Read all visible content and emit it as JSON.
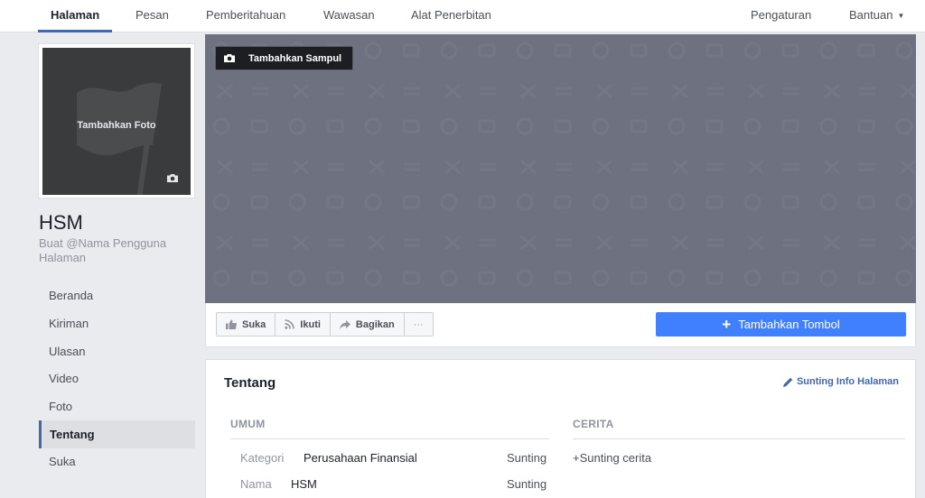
{
  "nav": {
    "items": [
      "Halaman",
      "Pesan",
      "Pemberitahuan",
      "Wawasan",
      "Alat Penerbitan"
    ],
    "settings": "Pengaturan",
    "help": "Bantuan"
  },
  "profile": {
    "add_photo": "Tambahkan Foto",
    "page_name": "HSM",
    "username_prompt": "Buat @Nama Pengguna Halaman"
  },
  "sidebar": {
    "items": [
      "Beranda",
      "Kiriman",
      "Ulasan",
      "Video",
      "Foto",
      "Tentang",
      "Suka"
    ],
    "active": "Tentang"
  },
  "cover": {
    "add_cover": "Tambahkan Sampul"
  },
  "actions": {
    "like": "Suka",
    "follow": "Ikuti",
    "share": "Bagikan",
    "more": "···",
    "add_button": "Tambahkan Tombol"
  },
  "about": {
    "title": "Tentang",
    "edit_info": "Sunting Info Halaman",
    "general_header": "UMUM",
    "story_header": "CERITA",
    "story_edit": "+Sunting cerita",
    "rows": [
      {
        "label": "Kategori",
        "value": "Perusahaan Finansial",
        "edit": "Sunting"
      },
      {
        "label": "Nama",
        "value": "HSM",
        "edit": "Sunting"
      }
    ]
  },
  "colors": {
    "brand_blue": "#4267b2",
    "button_blue": "#4080ff",
    "cover_gray": "#6d7180",
    "background": "#e9ebee"
  }
}
